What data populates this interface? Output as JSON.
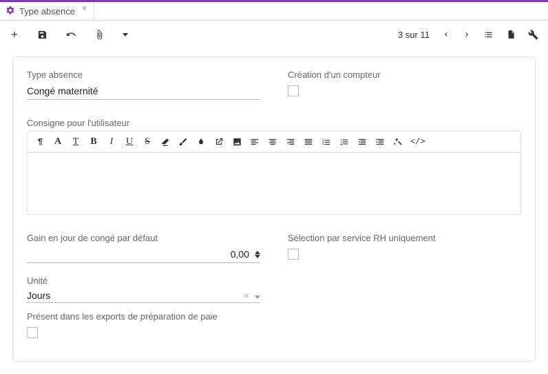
{
  "tab": {
    "title": "Type absence"
  },
  "pager": {
    "text": "3 sur 11"
  },
  "form": {
    "type_absence_label": "Type absence",
    "type_absence_value": "Congé maternité",
    "creation_compteur_label": "Création d'un compteur",
    "creation_compteur_checked": false,
    "consigne_label": "Consigne pour l'utilisateur",
    "gain_label": "Gain en jour de congé par défaut",
    "gain_value": "0,00",
    "selection_rh_label": "Sélection par service RH uniquement",
    "selection_rh_checked": false,
    "unite_label": "Unité",
    "unite_value": "Jours",
    "present_export_label": "Présent dans les exports de préparation de paie",
    "present_export_checked": false
  }
}
